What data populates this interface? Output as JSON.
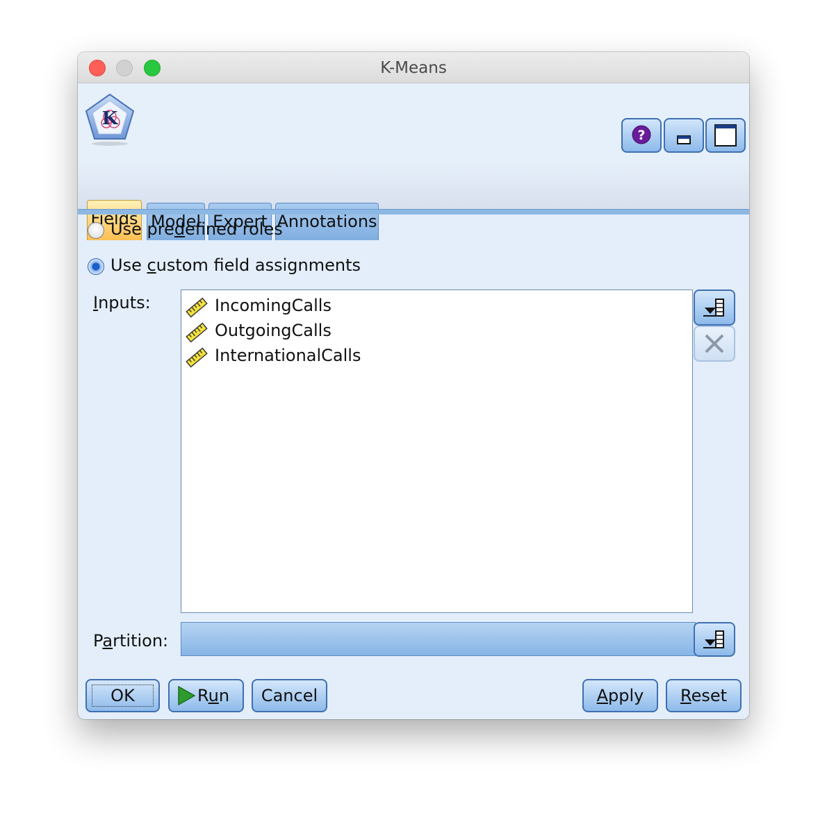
{
  "window": {
    "title": "K-Means"
  },
  "header_buttons": {
    "help_icon": "help-icon",
    "minimize_icon": "minimize-icon",
    "maximize_icon": "maximize-icon"
  },
  "tabs": [
    {
      "label": "Fields",
      "active": true
    },
    {
      "label": "Model",
      "active": false
    },
    {
      "label": "Expert",
      "active": false
    },
    {
      "label": "Annotations",
      "active": false
    }
  ],
  "fields": {
    "radio_predefined": {
      "pre": "Use pre",
      "mnemonic": "d",
      "post": "efined roles",
      "checked": false
    },
    "radio_custom": {
      "pre": "Use ",
      "mnemonic": "c",
      "post": "ustom field assignments",
      "checked": true
    },
    "inputs_label": {
      "mnemonic": "I",
      "post": "nputs:"
    },
    "inputs": [
      "IncomingCalls",
      "OutgoingCalls",
      "InternationalCalls"
    ],
    "partition_label": {
      "pre": "P",
      "mnemonic": "a",
      "post": "rtition:"
    },
    "partition_value": ""
  },
  "buttons": {
    "ok": "OK",
    "run": {
      "pre": "R",
      "mnemonic": "u",
      "post": "n"
    },
    "cancel": "Cancel",
    "apply": {
      "mnemonic": "A",
      "post": "pply"
    },
    "reset": {
      "mnemonic": "R",
      "post": "eset"
    }
  },
  "colors": {
    "accent": "#3e6fb0",
    "active_tab": "#fdbf52",
    "run_icon": "#2e9b2e"
  }
}
